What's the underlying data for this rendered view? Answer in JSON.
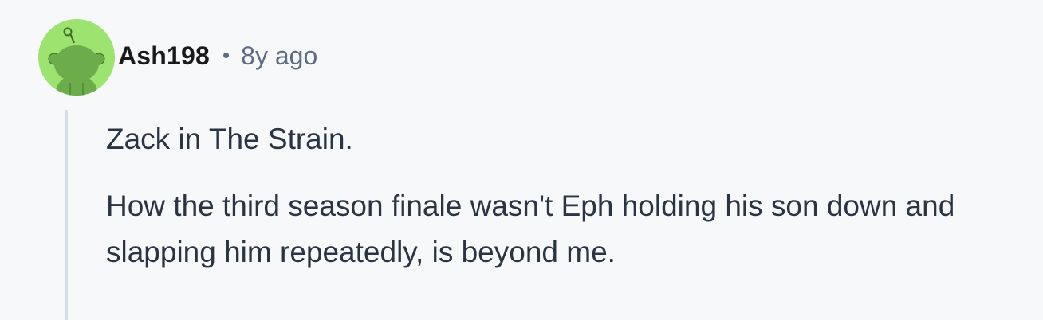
{
  "comment": {
    "author": "Ash198",
    "separator": "•",
    "timestamp": "8y ago",
    "avatar": {
      "icon": "reddit-snoo-icon",
      "background": "#9ce36f",
      "figure": "#6cac4a"
    },
    "paragraphs": [
      "Zack in The Strain.",
      "How the third season finale wasn't Eph holding his son down and slapping him repeatedly, is beyond me."
    ]
  }
}
